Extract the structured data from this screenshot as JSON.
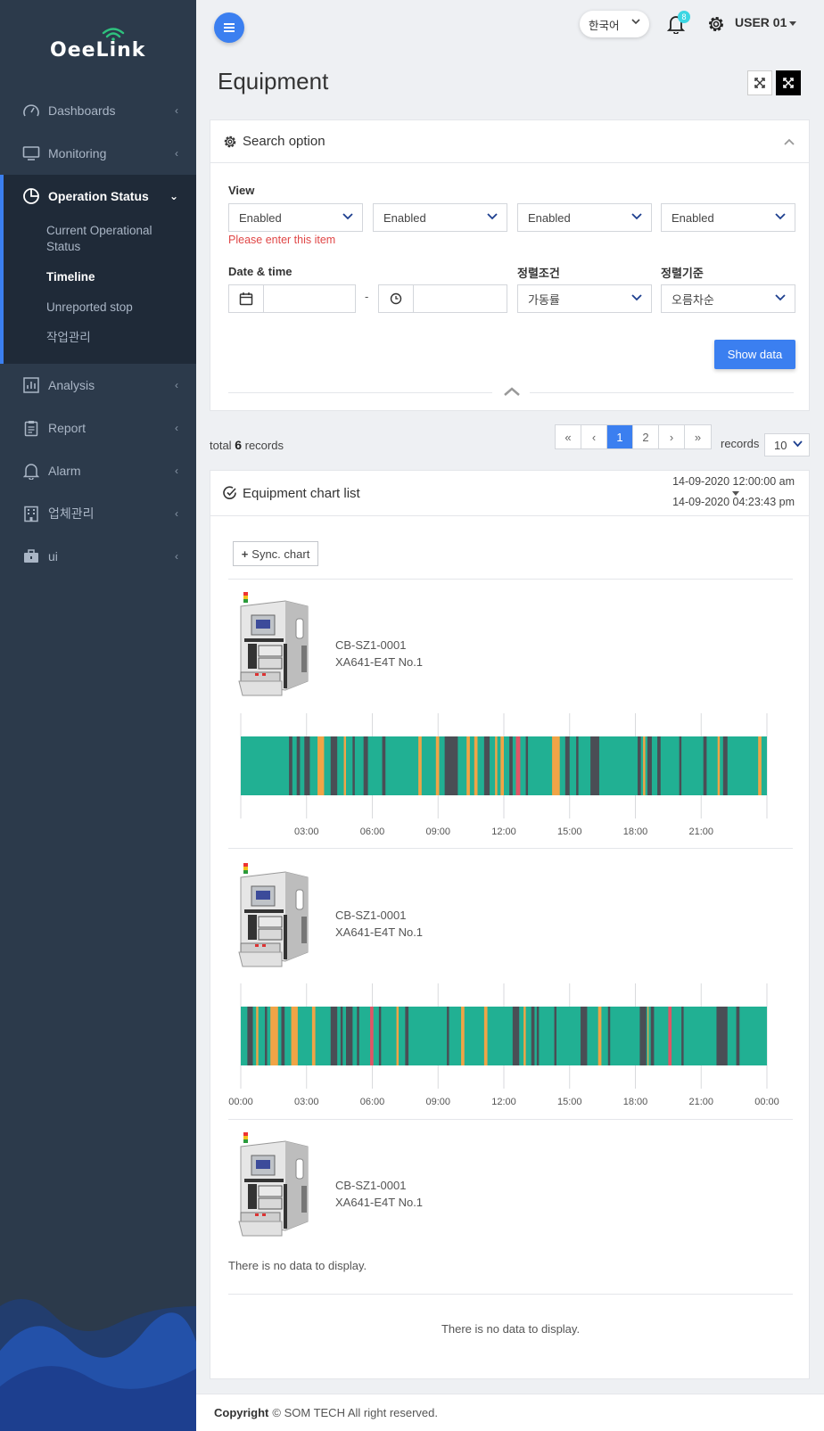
{
  "app": {
    "logo": "OeeLink"
  },
  "sidebar": {
    "items": [
      {
        "label": "Dashboards",
        "icon": "gauge-icon"
      },
      {
        "label": "Monitoring",
        "icon": "monitor-icon"
      },
      {
        "label": "Operation Status",
        "icon": "pie-chart-icon"
      },
      {
        "label": "Analysis",
        "icon": "bar-chart-icon"
      },
      {
        "label": "Report",
        "icon": "clipboard-icon"
      },
      {
        "label": "Alarm",
        "icon": "bell-icon"
      },
      {
        "label": "업체관리",
        "icon": "building-icon"
      },
      {
        "label": "ui",
        "icon": "briefcase-icon"
      }
    ],
    "operation_sub": [
      {
        "label": "Current Operational Status"
      },
      {
        "label": "Timeline",
        "active": true
      },
      {
        "label": "Unreported stop"
      },
      {
        "label": "작업관리"
      }
    ]
  },
  "header": {
    "language": "한국어",
    "notifications": "8",
    "user": "USER 01"
  },
  "page": {
    "title": "Equipment"
  },
  "search": {
    "title": "Search option",
    "view_label": "View",
    "view_selects": [
      "Enabled",
      "Enabled",
      "Enabled",
      "Enabled"
    ],
    "view_error": "Please enter this item",
    "datetime_label": "Date & time",
    "date_value": "",
    "time_value": "",
    "range_separator": "-",
    "sort_cond_label": "정렬조건",
    "sort_cond_value": "가동률",
    "sort_order_label": "정렬기준",
    "sort_order_value": "오름차순",
    "show_button": "Show data"
  },
  "results": {
    "total_prefix": "total",
    "total_count": "6",
    "total_suffix": "records",
    "pages": [
      "«",
      "‹",
      "1",
      "2",
      "›",
      "»"
    ],
    "current_page": "1",
    "records_label": "records",
    "records_value": "10"
  },
  "chart_list": {
    "title": "Equipment chart list",
    "range_start": "14-09-2020 12:00:00 am",
    "range_end": "14-09-2020 04:23:43 pm",
    "sync_button": "Sync. chart",
    "equipment": [
      {
        "code": "CB-SZ1-0001",
        "name": "XA641-E4T No.1"
      },
      {
        "code": "CB-SZ1-0001",
        "name": "XA641-E4T No.1"
      },
      {
        "code": "CB-SZ1-0001",
        "name": "XA641-E4T No.1"
      }
    ],
    "no_data_1": "There is no data to display.",
    "no_data_2": "There is no data to display."
  },
  "chart_data": [
    {
      "type": "timeline",
      "x_range_hours": [
        0,
        24
      ],
      "x_ticks": [
        "03:00",
        "06:00",
        "09:00",
        "12:00",
        "15:00",
        "18:00",
        "21:00"
      ],
      "colors": {
        "run": "#21b093",
        "stop": "#4a4e55",
        "idle": "#f0a446",
        "alarm": "#e05566"
      },
      "base_state": "run",
      "segments": [
        {
          "start": 2.2,
          "end": 2.35,
          "state": "stop"
        },
        {
          "start": 2.55,
          "end": 2.7,
          "state": "stop"
        },
        {
          "start": 2.9,
          "end": 3.15,
          "state": "stop"
        },
        {
          "start": 3.5,
          "end": 3.8,
          "state": "idle"
        },
        {
          "start": 4.1,
          "end": 4.4,
          "state": "stop"
        },
        {
          "start": 4.7,
          "end": 4.8,
          "state": "idle"
        },
        {
          "start": 5.1,
          "end": 5.2,
          "state": "stop"
        },
        {
          "start": 5.6,
          "end": 5.8,
          "state": "stop"
        },
        {
          "start": 6.45,
          "end": 6.6,
          "state": "stop"
        },
        {
          "start": 8.1,
          "end": 8.25,
          "state": "idle"
        },
        {
          "start": 8.9,
          "end": 9.05,
          "state": "idle"
        },
        {
          "start": 9.3,
          "end": 9.9,
          "state": "stop"
        },
        {
          "start": 10.3,
          "end": 10.45,
          "state": "idle"
        },
        {
          "start": 10.65,
          "end": 10.8,
          "state": "idle"
        },
        {
          "start": 11.1,
          "end": 11.35,
          "state": "stop"
        },
        {
          "start": 11.6,
          "end": 11.7,
          "state": "idle"
        },
        {
          "start": 11.85,
          "end": 12.0,
          "state": "idle"
        },
        {
          "start": 12.25,
          "end": 12.4,
          "state": "stop"
        },
        {
          "start": 12.55,
          "end": 12.75,
          "state": "alarm"
        },
        {
          "start": 13.0,
          "end": 13.1,
          "state": "stop"
        },
        {
          "start": 14.2,
          "end": 14.55,
          "state": "idle"
        },
        {
          "start": 14.8,
          "end": 15.0,
          "state": "stop"
        },
        {
          "start": 15.3,
          "end": 15.4,
          "state": "stop"
        },
        {
          "start": 15.95,
          "end": 16.35,
          "state": "stop"
        },
        {
          "start": 18.1,
          "end": 18.25,
          "state": "stop"
        },
        {
          "start": 18.35,
          "end": 18.45,
          "state": "idle"
        },
        {
          "start": 18.55,
          "end": 18.75,
          "state": "stop"
        },
        {
          "start": 19.0,
          "end": 19.15,
          "state": "stop"
        },
        {
          "start": 20.0,
          "end": 20.1,
          "state": "stop"
        },
        {
          "start": 21.1,
          "end": 21.25,
          "state": "stop"
        },
        {
          "start": 21.75,
          "end": 21.85,
          "state": "idle"
        },
        {
          "start": 22.0,
          "end": 22.2,
          "state": "stop"
        },
        {
          "start": 23.6,
          "end": 23.75,
          "state": "idle"
        }
      ]
    },
    {
      "type": "timeline",
      "x_range_hours": [
        0,
        24
      ],
      "x_ticks": [
        "00:00",
        "03:00",
        "06:00",
        "09:00",
        "12:00",
        "15:00",
        "18:00",
        "21:00",
        "00:00"
      ],
      "colors": {
        "run": "#21b093",
        "stop": "#4a4e55",
        "idle": "#f0a446",
        "alarm": "#e05566"
      },
      "base_state": "run",
      "segments": [
        {
          "start": 0.3,
          "end": 0.55,
          "state": "stop"
        },
        {
          "start": 0.7,
          "end": 0.8,
          "state": "idle"
        },
        {
          "start": 1.1,
          "end": 1.2,
          "state": "stop"
        },
        {
          "start": 1.35,
          "end": 1.7,
          "state": "idle"
        },
        {
          "start": 1.85,
          "end": 2.0,
          "state": "stop"
        },
        {
          "start": 2.3,
          "end": 2.6,
          "state": "idle"
        },
        {
          "start": 3.25,
          "end": 3.4,
          "state": "idle"
        },
        {
          "start": 4.1,
          "end": 4.4,
          "state": "stop"
        },
        {
          "start": 4.55,
          "end": 4.65,
          "state": "stop"
        },
        {
          "start": 4.8,
          "end": 5.1,
          "state": "stop"
        },
        {
          "start": 5.3,
          "end": 5.4,
          "state": "stop"
        },
        {
          "start": 5.9,
          "end": 6.05,
          "state": "alarm"
        },
        {
          "start": 6.3,
          "end": 6.4,
          "state": "stop"
        },
        {
          "start": 7.1,
          "end": 7.2,
          "state": "idle"
        },
        {
          "start": 7.5,
          "end": 7.65,
          "state": "stop"
        },
        {
          "start": 9.4,
          "end": 9.5,
          "state": "stop"
        },
        {
          "start": 10.05,
          "end": 10.2,
          "state": "idle"
        },
        {
          "start": 11.1,
          "end": 11.25,
          "state": "idle"
        },
        {
          "start": 12.4,
          "end": 12.7,
          "state": "stop"
        },
        {
          "start": 12.9,
          "end": 13.0,
          "state": "idle"
        },
        {
          "start": 13.25,
          "end": 13.4,
          "state": "stop"
        },
        {
          "start": 13.5,
          "end": 13.6,
          "state": "stop"
        },
        {
          "start": 14.3,
          "end": 14.4,
          "state": "stop"
        },
        {
          "start": 15.5,
          "end": 15.8,
          "state": "stop"
        },
        {
          "start": 16.3,
          "end": 16.45,
          "state": "idle"
        },
        {
          "start": 16.75,
          "end": 16.85,
          "state": "stop"
        },
        {
          "start": 18.2,
          "end": 18.5,
          "state": "stop"
        },
        {
          "start": 18.55,
          "end": 18.6,
          "state": "idle"
        },
        {
          "start": 18.7,
          "end": 18.85,
          "state": "stop"
        },
        {
          "start": 19.5,
          "end": 19.65,
          "state": "alarm"
        },
        {
          "start": 20.1,
          "end": 20.2,
          "state": "stop"
        },
        {
          "start": 21.7,
          "end": 22.2,
          "state": "stop"
        },
        {
          "start": 22.6,
          "end": 22.75,
          "state": "stop"
        }
      ]
    }
  ]
}
